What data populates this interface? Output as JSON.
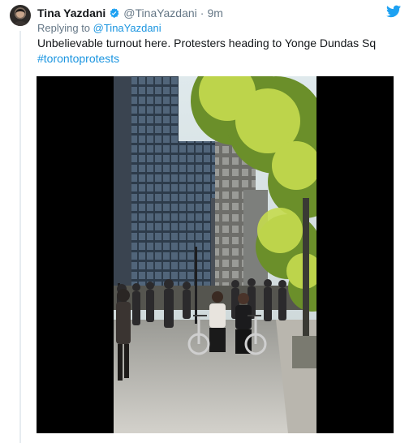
{
  "tweet": {
    "author_name": "Tina Yazdani",
    "handle": "@TinaYazdani",
    "separator": "·",
    "timestamp": "9m",
    "reply_prefix": "Replying to ",
    "reply_to": "@TinaYazdani",
    "text": "Unbelievable turnout here. Protesters heading to Yonge Dundas Sq",
    "hashtag": "#torontoprotests"
  },
  "colors": {
    "link": "#1b95e0",
    "secondary_text": "#657786",
    "twitter_blue": "#1da1f2"
  },
  "icons": {
    "verified": "verified-badge-icon",
    "brand": "twitter-bird-icon"
  }
}
